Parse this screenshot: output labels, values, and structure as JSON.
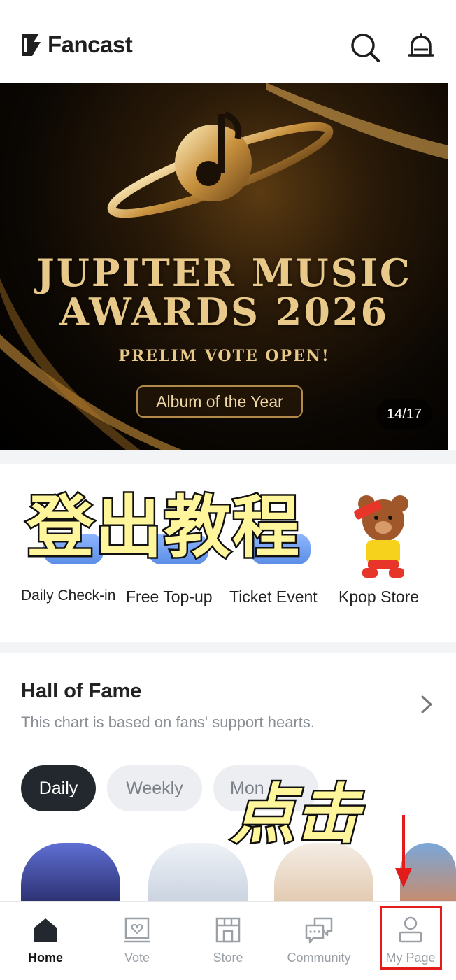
{
  "header": {
    "app_name": "Fancast",
    "icons": [
      "search-icon",
      "notification-bell-icon"
    ]
  },
  "banner": {
    "title_line1": "JUPITER MUSIC",
    "title_line2": "AWARDS 2026",
    "subtitle": "PRELIM VOTE OPEN!",
    "button_label": "Album of the Year",
    "counter": "14/17"
  },
  "shortcuts": [
    {
      "label": "Daily Check-in",
      "icon": "calendar-icon"
    },
    {
      "label": "Free Top-up",
      "icon": "ticket-icon"
    },
    {
      "label": "Ticket Event",
      "icon": "gift-icon"
    },
    {
      "label": "Kpop Store",
      "icon": "bear-icon"
    }
  ],
  "overlay": {
    "tutorial_text": "登出教程",
    "tap_text": "点击"
  },
  "hall_of_fame": {
    "title": "Hall of Fame",
    "subtitle": "This chart is based on fans' support hearts.",
    "tabs": [
      "Daily",
      "Weekly",
      "Mon"
    ],
    "active_tab": "Daily"
  },
  "nav": {
    "items": [
      {
        "label": "Home",
        "icon": "home-icon"
      },
      {
        "label": "Vote",
        "icon": "vote-box-icon"
      },
      {
        "label": "Store",
        "icon": "store-icon"
      },
      {
        "label": "Community",
        "icon": "chat-icon"
      },
      {
        "label": "My Page",
        "icon": "user-icon"
      }
    ],
    "active": "Home"
  },
  "colors": {
    "highlight": "#e31b1b",
    "overlay_text": "#fff59a",
    "gold": "#e8c98a"
  }
}
